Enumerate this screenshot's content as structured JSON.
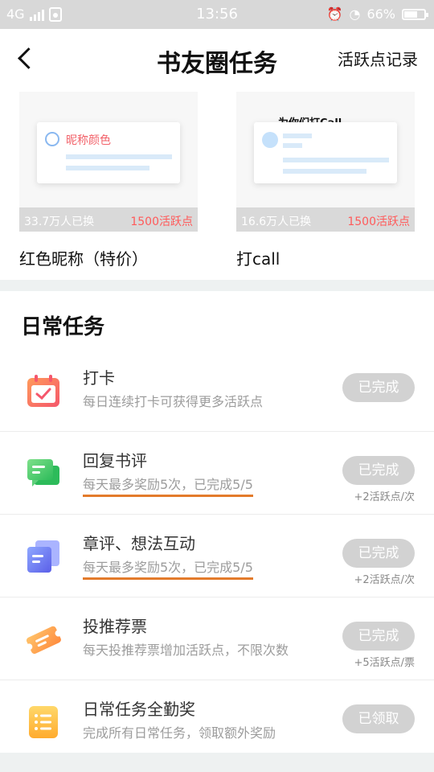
{
  "status_bar": {
    "network": "4G",
    "time": "13:56",
    "battery": "66%",
    "battery_level": 0.66
  },
  "header": {
    "title": "书友圈任务",
    "record_link": "活跃点记录"
  },
  "cards": [
    {
      "preview_label": "昵称颜色",
      "count": "33.7万人已换",
      "points": "1500活跃点",
      "name": "红色昵称（特价）"
    },
    {
      "preview_label": "为你们打Call",
      "count": "16.6万人已换",
      "points": "1500活跃点",
      "name": "打call"
    }
  ],
  "daily": {
    "title": "日常任务",
    "tasks": [
      {
        "name": "打卡",
        "desc": "每日连续打卡可获得更多活跃点",
        "status": "已完成",
        "reward": ""
      },
      {
        "name": "回复书评",
        "desc": "每天最多奖励5次，已完成5/5",
        "status": "已完成",
        "reward": "+2活跃点/次"
      },
      {
        "name": "章评、想法互动",
        "desc": "每天最多奖励5次，已完成5/5",
        "status": "已完成",
        "reward": "+2活跃点/次"
      },
      {
        "name": "投推荐票",
        "desc": "每天投推荐票增加活跃点，不限次数",
        "status": "已完成",
        "reward": "+5活跃点/票"
      },
      {
        "name": "日常任务全勤奖",
        "desc": "完成所有日常任务，领取额外奖励",
        "status": "已领取",
        "reward": ""
      }
    ]
  }
}
